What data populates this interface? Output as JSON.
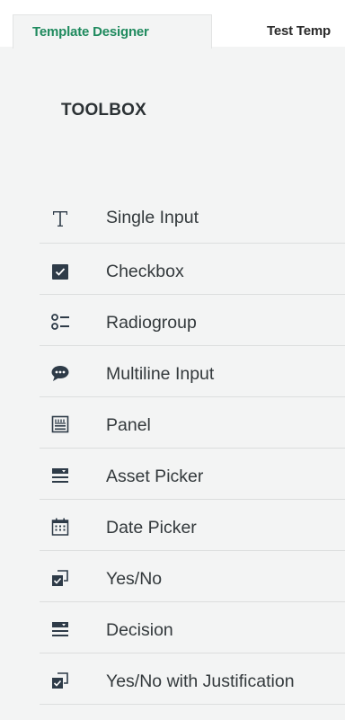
{
  "tabs": [
    {
      "label": "Template Designer",
      "active": true
    },
    {
      "label": "Test Temp",
      "active": false
    }
  ],
  "toolbox": {
    "title": "TOOLBOX",
    "items": [
      {
        "label": "Single Input",
        "icon": "text-icon"
      },
      {
        "label": "Checkbox",
        "icon": "checkbox-icon"
      },
      {
        "label": "Radiogroup",
        "icon": "radiogroup-icon"
      },
      {
        "label": "Multiline Input",
        "icon": "comment-icon"
      },
      {
        "label": "Panel",
        "icon": "panel-icon"
      },
      {
        "label": "Asset Picker",
        "icon": "dropdown-list-icon"
      },
      {
        "label": "Date Picker",
        "icon": "calendar-icon"
      },
      {
        "label": "Yes/No",
        "icon": "boolean-icon"
      },
      {
        "label": "Decision",
        "icon": "dropdown-list-icon"
      },
      {
        "label": "Yes/No with Justification",
        "icon": "boolean-icon"
      }
    ]
  },
  "colors": {
    "accent": "#1f8a5e",
    "icon": "#2e3b48",
    "text": "#33393c",
    "background": "#f3f4f4"
  }
}
